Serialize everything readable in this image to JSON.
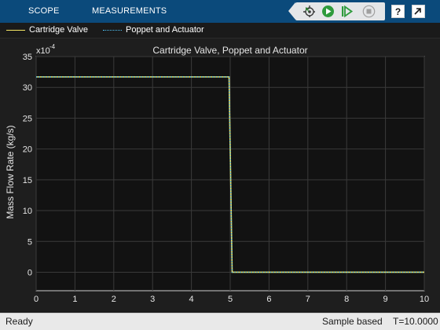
{
  "toolstrip": {
    "tabs": [
      {
        "label": "SCOPE"
      },
      {
        "label": "MEASUREMENTS"
      }
    ],
    "buttons": [
      {
        "icon": "highlight-signal-icon"
      },
      {
        "icon": "run-icon"
      },
      {
        "icon": "step-forward-icon"
      },
      {
        "icon": "stop-icon"
      },
      {
        "icon": "help-icon"
      },
      {
        "icon": "undock-icon"
      }
    ]
  },
  "legend": {
    "items": [
      {
        "label": "Cartridge Valve",
        "color": "#f5e663",
        "style": "solid"
      },
      {
        "label": "Poppet and Actuator",
        "color": "#4fc3f7",
        "style": "dotted"
      }
    ]
  },
  "chart_data": {
    "type": "line",
    "title": "Cartridge Valve, Poppet and Actuator",
    "xlabel": "",
    "ylabel": "Mass Flow Rate (kg/s)",
    "y_exponent_label": "x10",
    "y_exponent": "-4",
    "xlim": [
      0,
      10
    ],
    "ylim": [
      -3,
      35
    ],
    "x_ticks": [
      0,
      1,
      2,
      3,
      4,
      5,
      6,
      7,
      8,
      9,
      10
    ],
    "y_ticks": [
      0,
      5,
      10,
      15,
      20,
      25,
      30,
      35
    ],
    "grid": true,
    "legend_position": "top",
    "series": [
      {
        "name": "Cartridge Valve",
        "color": "#f5e663",
        "style": "solid",
        "points": [
          [
            0,
            31.7
          ],
          [
            4.97,
            31.7
          ],
          [
            5.05,
            0
          ],
          [
            10,
            0
          ]
        ]
      },
      {
        "name": "Poppet and Actuator",
        "color": "#4fc3f7",
        "style": "dotted",
        "points": [
          [
            0,
            31.7
          ],
          [
            4.97,
            31.7
          ],
          [
            5.05,
            0
          ],
          [
            10,
            0
          ]
        ]
      }
    ]
  },
  "status": {
    "left": "Ready",
    "mode": "Sample based",
    "time": "T=10.0000"
  }
}
